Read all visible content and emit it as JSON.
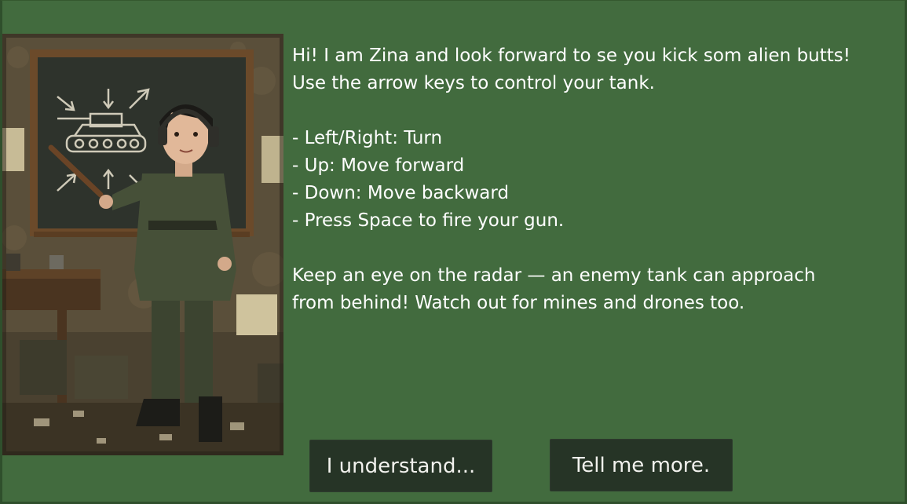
{
  "dialog": {
    "lines": [
      "Hi! I am Zina and look forward to se you kick som alien butts!",
      "Use the arrow keys to control your tank.",
      "",
      "- Left/Right: Turn",
      "- Up: Move forward",
      "- Down: Move backward",
      "- Press Space to fire your gun.",
      "",
      "Keep an eye on the radar — an enemy tank can approach",
      "from behind! Watch out for mines and drones too."
    ]
  },
  "buttons": {
    "understand_label": "I understand...",
    "more_label": "Tell me more."
  },
  "colors": {
    "background": "#426b3e",
    "button": "#263426",
    "text": "#ffffff"
  }
}
